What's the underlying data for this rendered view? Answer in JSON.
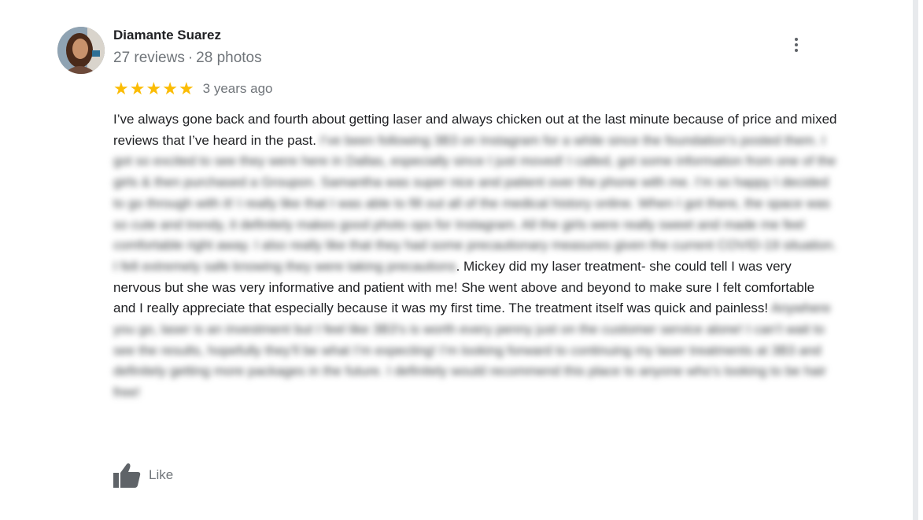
{
  "review": {
    "author": "Diamante Suarez",
    "reviews_count": "27 reviews",
    "separator": "·",
    "photos_count": "28 photos",
    "rating": 5,
    "time_ago": "3 years ago",
    "text_visible_1": "I’ve always gone back and fourth about getting laser and always chicken out at the last minute because of price and mixed reviews that I’ve heard in the past.",
    "text_blurred_1": "I’ve been following 3B3 on Instagram for a while since the foundation’s posted them. I got so excited to see they were here in Dallas, especially since I just moved! I called, got some information from one of the girls & then purchased a Groupon. Samantha was super nice and patient over the phone with me. I’m so happy I decided to go through with it! I really like that I was able to fill out all of the medical history online. When I got there, the space was so cute and trendy, it definitely makes good photo ops for Instagram. All the girls were really sweet and made me feel comfortable right away. I also really like that they had some precautionary measures given the current COVID-19 situation. I felt extremely safe knowing they were taking precautions",
    "text_visible_2": ". Mickey did my laser treatment- she could tell I was very nervous but she was very informative and patient with me! She went above and beyond to make sure I felt comfortable and I really appreciate that especially because it was my first time. The treatment itself was quick and painless!",
    "text_blurred_2": "Anywhere you go, laser is an investment but I feel like 3B3’s is worth every penny just on the customer service alone! I can’t wait to see the results, hopefully they’ll be what I’m expecting! I’m looking forward to continuing my laser treatments at 3B3 and definitely getting more packages in the future. I definitely would recommend this place to anyone who’s looking to be hair free!",
    "like_label": "Like",
    "icons": {
      "more": "more-vert-icon",
      "like": "thumb-up-icon",
      "star": "star-icon"
    },
    "colors": {
      "star": "#fbbc04",
      "secondary_text": "#70757a"
    }
  }
}
